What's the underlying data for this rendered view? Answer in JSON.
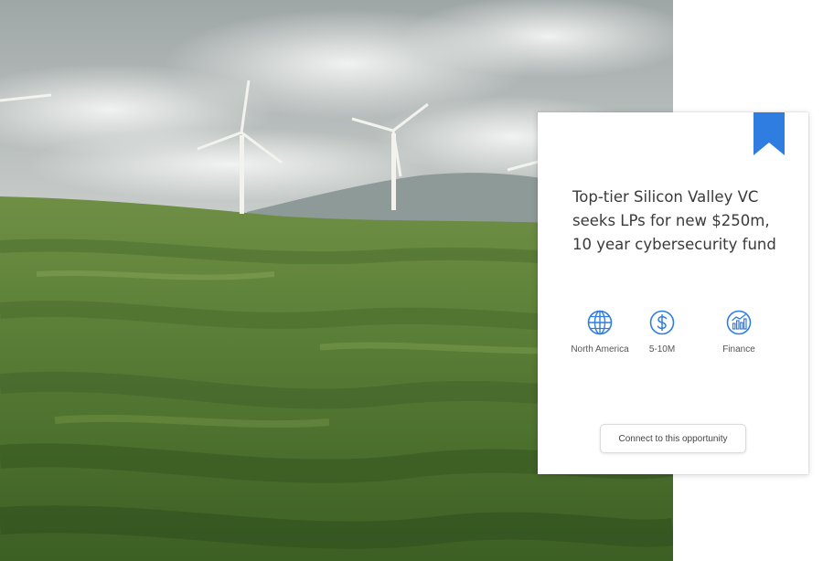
{
  "hero": {
    "icon": "landscape-wind-turbines-photo"
  },
  "card": {
    "bookmark_icon": "bookmark-icon",
    "accent_color": "#2f7de1",
    "title": "Top-tier Silicon Valley VC seeks LPs for new $250m, 10 year cybersecurity fund",
    "meta": [
      {
        "icon": "globe-icon",
        "label": "North America"
      },
      {
        "icon": "dollar-icon",
        "label": "5-10M"
      },
      {
        "icon": "chart-icon",
        "label": "Finance"
      }
    ],
    "cta_label": "Connect to this opportunity"
  }
}
